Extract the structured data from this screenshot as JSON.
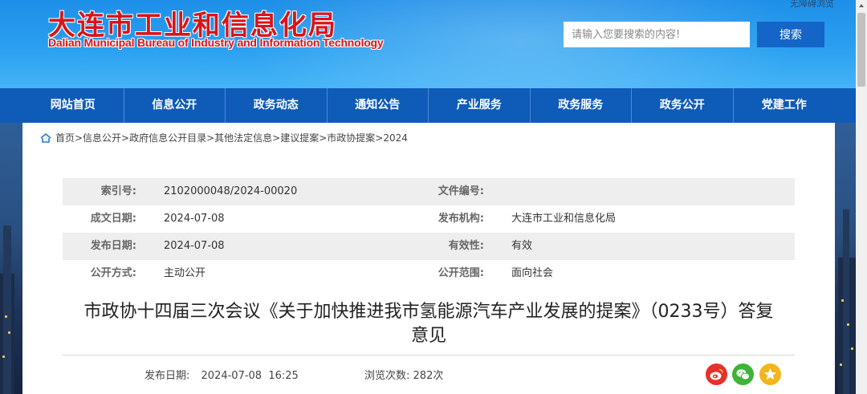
{
  "header": {
    "logo_cn": "大连市工业和信息化局",
    "logo_en": "Dalian Municipal Bureau of Industry and Information Technology",
    "accessibility_label": "无障碍浏览",
    "search": {
      "placeholder": "请输入您要搜索的内容!",
      "button_label": "搜索"
    }
  },
  "nav": {
    "items": [
      "网站首页",
      "信息公开",
      "政务动态",
      "通知公告",
      "产业服务",
      "政务服务",
      "政务公开",
      "党建工作"
    ]
  },
  "breadcrumb": "首页>信息公开>政府信息公开目录>其他法定信息>建议提案>市政协提案>2024",
  "meta": {
    "index_no_label": "索引号:",
    "index_no": "2102000048/2024-00020",
    "doc_no_label": "文件编号:",
    "doc_no": "",
    "created_label": "成文日期:",
    "created": "2024-07-08",
    "publisher_label": "发布机构:",
    "publisher": "大连市工业和信息化局",
    "pub_date_label": "发布日期:",
    "pub_date": "2024-07-08",
    "validity_label": "有效性:",
    "validity": "有效",
    "method_label": "公开方式:",
    "method": "主动公开",
    "scope_label": "公开范围:",
    "scope": "面向社会"
  },
  "article": {
    "title_line1": "市政协十四届三次会议《关于加快推进我市氢能源汽车产业发展的提案》（0233号）答复",
    "title_line2": "意见",
    "pub_label": "发布日期:",
    "pub_datetime": "2024-07-08  16:25",
    "views_label": "浏览次数:",
    "views_value": "282次"
  },
  "share_icons": [
    "weibo-icon",
    "wechat-icon",
    "favorite-icon"
  ],
  "colors": {
    "header_blue": "#1e8fe8",
    "nav_blue": "#0f5bb8",
    "logo_red": "#d8141a",
    "button_blue": "#1565c9"
  }
}
